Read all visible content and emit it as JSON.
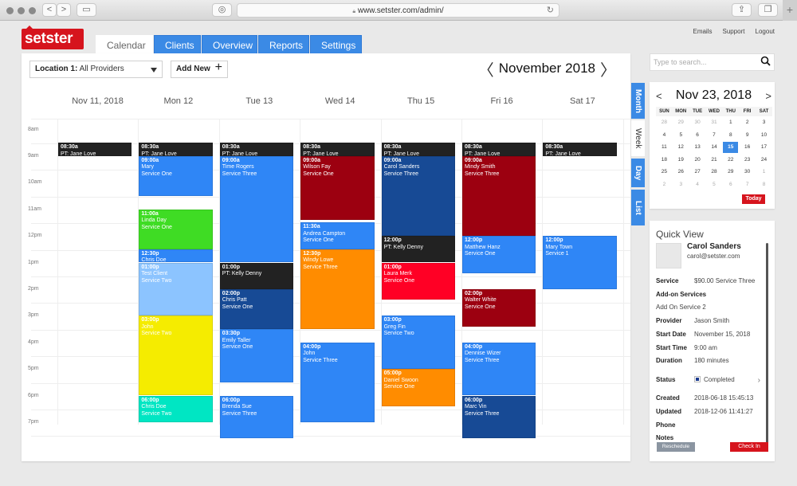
{
  "browser": {
    "url": "www.setster.com/admin/",
    "back": "<",
    "forward": ">",
    "plus": "+"
  },
  "app": {
    "logo": "setster",
    "tabs": [
      {
        "label": "Calendar",
        "active": true
      },
      {
        "label": "Clients"
      },
      {
        "label": "Overview"
      },
      {
        "label": "Reports"
      },
      {
        "label": "Settings"
      }
    ],
    "top_links": [
      "Emails",
      "Support",
      "Logout"
    ]
  },
  "toolbar": {
    "location_label": "Location 1:",
    "location_value": "All Providers",
    "add_new": "Add New",
    "add_icon": "+",
    "month": "November",
    "year": "2018",
    "prev": "〈",
    "next": "〉"
  },
  "calendar": {
    "days": [
      "Nov 11, 2018",
      "Mon 12",
      "Tue 13",
      "Wed 14",
      "Thu 15",
      "Fri 16",
      "Sat 17"
    ],
    "hours": [
      "8am",
      "9am",
      "10am",
      "11am",
      "12pm",
      "1pm",
      "2pm",
      "3pm",
      "4pm",
      "5pm",
      "6pm",
      "7pm"
    ],
    "colors": {
      "black": "#222222",
      "blue": "#2f86f6",
      "darkblue": "#174a95",
      "darkred": "#9c0010",
      "red": "#ff0025",
      "green": "#3fdc24",
      "lightblue": "#8cc4ff",
      "yellow": "#f5ec00",
      "teal": "#00e6c3",
      "orange": "#ff8c00"
    },
    "events": [
      {
        "day": 0,
        "start": 8.5,
        "end": 9.0,
        "color": "black",
        "time": "08:30a",
        "name": "PT: Jane Love",
        "service": ""
      },
      {
        "day": 1,
        "start": 8.5,
        "end": 9.0,
        "color": "black",
        "time": "08:30a",
        "name": "PT: Jane Love",
        "service": ""
      },
      {
        "day": 1,
        "start": 9.0,
        "end": 10.5,
        "color": "blue",
        "time": "09:00a",
        "name": "Mary",
        "service": "Service One"
      },
      {
        "day": 1,
        "start": 11.0,
        "end": 12.5,
        "color": "green",
        "time": "11:00a",
        "name": "Linda Day",
        "service": "Service One"
      },
      {
        "day": 1,
        "start": 12.5,
        "end": 13.0,
        "color": "blue",
        "time": "12:30p",
        "name": "Chris Doe",
        "service": ""
      },
      {
        "day": 1,
        "start": 13.0,
        "end": 15.0,
        "color": "lightblue",
        "time": "01:00p",
        "name": "Test Client",
        "service": "Service Two"
      },
      {
        "day": 1,
        "start": 15.0,
        "end": 18.0,
        "color": "yellow",
        "time": "03:00p",
        "name": "John",
        "service": "Service Two"
      },
      {
        "day": 1,
        "start": 18.0,
        "end": 19.0,
        "color": "teal",
        "time": "06:00p",
        "name": "Chris Doe",
        "service": "Service Two"
      },
      {
        "day": 2,
        "start": 8.5,
        "end": 9.0,
        "color": "black",
        "time": "08:30a",
        "name": "PT: Jane Love",
        "service": ""
      },
      {
        "day": 2,
        "start": 9.0,
        "end": 13.0,
        "color": "blue",
        "time": "09:00a",
        "name": "Time Rogers",
        "service": "Service Three"
      },
      {
        "day": 2,
        "start": 13.0,
        "end": 14.0,
        "color": "black",
        "time": "01:00p",
        "name": "PT: Kelly Denny",
        "service": ""
      },
      {
        "day": 2,
        "start": 14.0,
        "end": 15.5,
        "color": "darkblue",
        "time": "02:00p",
        "name": "Chris Patt",
        "service": "Service One"
      },
      {
        "day": 2,
        "start": 15.5,
        "end": 17.5,
        "color": "blue",
        "time": "03:30p",
        "name": "Emily Taller",
        "service": "Service One"
      },
      {
        "day": 2,
        "start": 18.0,
        "end": 19.6,
        "color": "blue",
        "time": "06:00p",
        "name": "Brenda Sue",
        "service": "Service Three"
      },
      {
        "day": 3,
        "start": 8.5,
        "end": 9.0,
        "color": "black",
        "time": "08:30a",
        "name": "PT: Jane Love",
        "service": ""
      },
      {
        "day": 3,
        "start": 9.0,
        "end": 11.4,
        "color": "darkred",
        "time": "09:00a",
        "name": "Wilson Fay",
        "service": "Service One"
      },
      {
        "day": 3,
        "start": 11.5,
        "end": 12.5,
        "color": "blue",
        "time": "11:30a",
        "name": "Andrea Campton",
        "service": "Service One"
      },
      {
        "day": 3,
        "start": 12.5,
        "end": 15.5,
        "color": "orange",
        "time": "12:30p",
        "name": "Windy Lowe",
        "service": "Service Three"
      },
      {
        "day": 3,
        "start": 16.0,
        "end": 19.0,
        "color": "blue",
        "time": "04:00p",
        "name": "John",
        "service": "Service Three"
      },
      {
        "day": 4,
        "start": 8.5,
        "end": 9.0,
        "color": "black",
        "time": "08:30a",
        "name": "PT: Jane Love",
        "service": ""
      },
      {
        "day": 4,
        "start": 9.0,
        "end": 12.0,
        "color": "darkblue",
        "time": "09:00a",
        "name": "Carol Sanders",
        "service": "Service Three"
      },
      {
        "day": 4,
        "start": 12.0,
        "end": 13.0,
        "color": "black",
        "time": "12:00p",
        "name": "PT: Kelly Denny",
        "service": ""
      },
      {
        "day": 4,
        "start": 13.0,
        "end": 14.4,
        "color": "red",
        "time": "01:00p",
        "name": "Laura Merk",
        "service": "Service One"
      },
      {
        "day": 4,
        "start": 15.0,
        "end": 17.0,
        "color": "blue",
        "time": "03:00p",
        "name": "Greg Fin",
        "service": "Service Two"
      },
      {
        "day": 4,
        "start": 17.0,
        "end": 18.4,
        "color": "orange",
        "time": "05:00p",
        "name": "Daniel Swoon",
        "service": "Service One"
      },
      {
        "day": 5,
        "start": 8.5,
        "end": 9.0,
        "color": "black",
        "time": "08:30a",
        "name": "PT: Jane Love",
        "service": ""
      },
      {
        "day": 5,
        "start": 9.0,
        "end": 12.0,
        "color": "darkred",
        "time": "09:00a",
        "name": "Mindy Smith",
        "service": "Service Three"
      },
      {
        "day": 5,
        "start": 12.0,
        "end": 13.4,
        "color": "blue",
        "time": "12:00p",
        "name": "Matthew Hanz",
        "service": "Service One"
      },
      {
        "day": 5,
        "start": 14.0,
        "end": 15.4,
        "color": "darkred",
        "time": "02:00p",
        "name": "Walter White",
        "service": "Service One"
      },
      {
        "day": 5,
        "start": 16.0,
        "end": 18.0,
        "color": "blue",
        "time": "04:00p",
        "name": "Dennise Wizer",
        "service": "Service Three"
      },
      {
        "day": 5,
        "start": 18.0,
        "end": 19.6,
        "color": "darkblue",
        "time": "06:00p",
        "name": "Marc Vin",
        "service": "Service Three"
      },
      {
        "day": 6,
        "start": 8.5,
        "end": 9.0,
        "color": "black",
        "time": "08:30a",
        "name": "PT: Jane Love",
        "service": ""
      },
      {
        "day": 6,
        "start": 12.0,
        "end": 14.0,
        "color": "blue",
        "time": "12:00p",
        "name": "Mary Town",
        "service": "Service 1"
      }
    ]
  },
  "view_tabs": [
    {
      "label": "Month",
      "active": false
    },
    {
      "label": "Week",
      "active": true
    },
    {
      "label": "Day",
      "active": false
    },
    {
      "label": "List",
      "active": false
    }
  ],
  "search": {
    "placeholder": "Type to search..."
  },
  "mini_calendar": {
    "title": "Nov 23, 2018",
    "prev": "<",
    "next": ">",
    "weekdays": [
      "SUN",
      "MON",
      "TUE",
      "WED",
      "THU",
      "FRI",
      "SAT"
    ],
    "weeks": [
      [
        "28",
        "29",
        "30",
        "31",
        "1",
        "2",
        "3"
      ],
      [
        "4",
        "5",
        "6",
        "7",
        "8",
        "9",
        "10"
      ],
      [
        "11",
        "12",
        "13",
        "14",
        "15",
        "16",
        "17"
      ],
      [
        "18",
        "19",
        "20",
        "21",
        "22",
        "23",
        "24"
      ],
      [
        "25",
        "26",
        "27",
        "28",
        "29",
        "30",
        "1"
      ],
      [
        "2",
        "3",
        "4",
        "5",
        "6",
        "7",
        "8"
      ]
    ],
    "selected": "15",
    "today_label": "Today"
  },
  "quick_view": {
    "title": "Quick View",
    "name": "Carol Sanders",
    "email": "carol@setster.com",
    "service_label": "Service",
    "service_value": "$90.00 Service Three",
    "addons_label": "Add-on Services",
    "addons_value": "Add On Service 2",
    "provider_label": "Provider",
    "provider_value": "Jason Smith",
    "start_date_label": "Start Date",
    "start_date_value": "November 15, 2018",
    "start_time_label": "Start Time",
    "start_time_value": "9:00 am",
    "duration_label": "Duration",
    "duration_value": "180 minutes",
    "status_label": "Status",
    "status_value": "Completed",
    "created_label": "Created",
    "created_value": "2018-06-18 15:45:13",
    "updated_label": "Updated",
    "updated_value": "2018-12-06 11:41:27",
    "phone_label": "Phone",
    "notes_label": "Notes",
    "reschedule": "Reschedule",
    "check_in": "Check In"
  }
}
